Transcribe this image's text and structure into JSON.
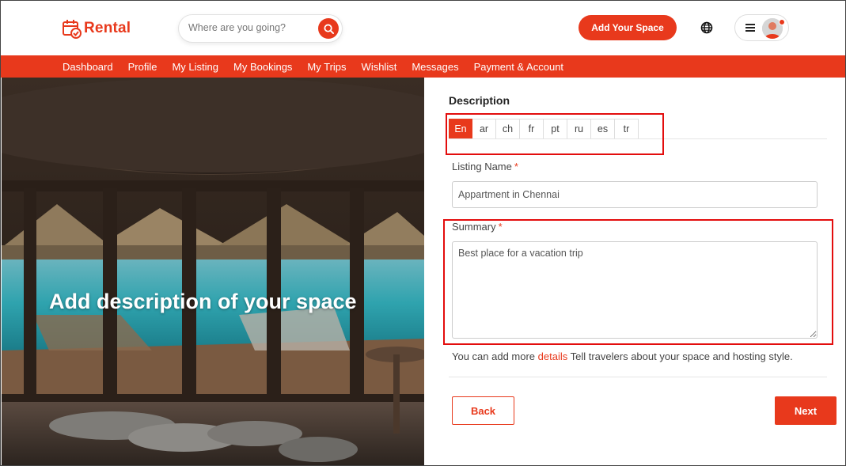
{
  "brand": {
    "name": "Rental",
    "accent_color": "#e8391c",
    "logo_icon": "calendar-check-icon"
  },
  "search": {
    "placeholder": "Where are you going?",
    "icon": "search-icon"
  },
  "header": {
    "add_space_label": "Add Your Space",
    "globe_icon": "globe-icon",
    "menu_icon": "hamburger-icon",
    "avatar_icon": "user-avatar"
  },
  "nav": {
    "items": [
      {
        "label": "Dashboard"
      },
      {
        "label": "Profile"
      },
      {
        "label": "My Listing"
      },
      {
        "label": "My Bookings"
      },
      {
        "label": "My Trips"
      },
      {
        "label": "Wishlist"
      },
      {
        "label": "Messages"
      },
      {
        "label": "Payment & Account"
      }
    ]
  },
  "hero": {
    "heading": "Add description of your space"
  },
  "form": {
    "section_title": "Description",
    "languages": [
      {
        "code": "En",
        "active": true
      },
      {
        "code": "ar",
        "active": false
      },
      {
        "code": "ch",
        "active": false
      },
      {
        "code": "fr",
        "active": false
      },
      {
        "code": "pt",
        "active": false
      },
      {
        "code": "ru",
        "active": false
      },
      {
        "code": "es",
        "active": false
      },
      {
        "code": "tr",
        "active": false
      }
    ],
    "listing_name": {
      "label": "Listing Name",
      "required_mark": "*",
      "value": "Appartment in Chennai"
    },
    "summary": {
      "label": "Summary",
      "required_mark": "*",
      "value": "Best place for a vacation trip"
    },
    "help": {
      "prefix": "You can add more ",
      "link": "details",
      "suffix": " Tell travelers about your space and hosting style."
    },
    "back_label": "Back",
    "next_label": "Next"
  }
}
